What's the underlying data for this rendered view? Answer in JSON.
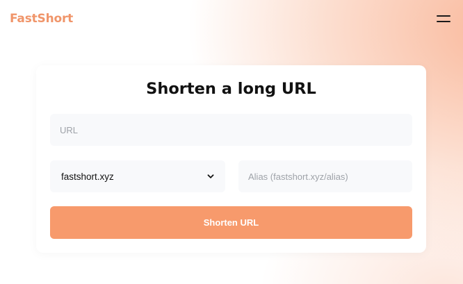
{
  "header": {
    "brand": "FastShort",
    "menu_icon": "hamburger-menu-icon"
  },
  "form": {
    "title": "Shorten a long URL",
    "url_placeholder": "URL",
    "domain_selected": "fastshort.xyz",
    "domain_dropdown_icon": "chevron-down-icon",
    "alias_placeholder": "Alias (fastshort.xyz/alias)",
    "submit_label": "Shorten URL"
  },
  "colors": {
    "brand": "#f0956a",
    "button": "#f79a6c",
    "background_glow": "#f8ac8a"
  }
}
